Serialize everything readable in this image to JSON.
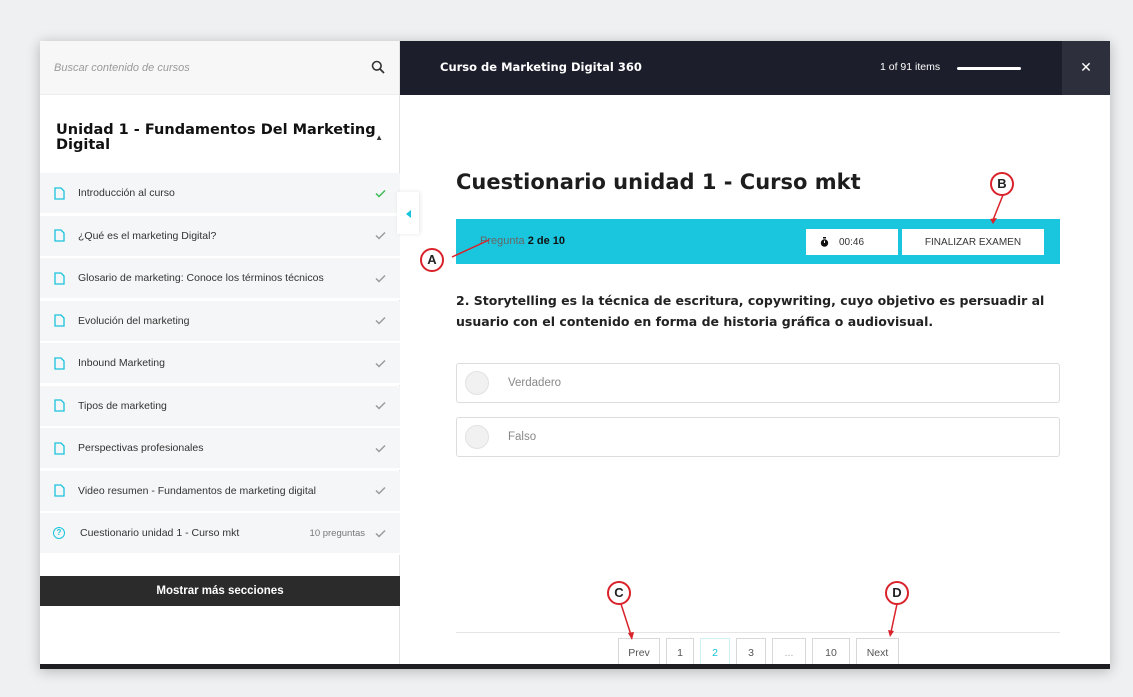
{
  "sidebar": {
    "search_placeholder": "Buscar contenido de cursos",
    "section_title": "Unidad 1 - Fundamentos Del Marketing Digital",
    "lessons": [
      {
        "label": "Introducción al curso",
        "meta": "",
        "completed": true
      },
      {
        "label": "¿Qué es el marketing Digital?",
        "meta": "",
        "completed": false
      },
      {
        "label": "Glosario de marketing: Conoce los términos técnicos",
        "meta": "",
        "completed": false
      },
      {
        "label": "Evolución del marketing",
        "meta": "",
        "completed": false
      },
      {
        "label": "Inbound Marketing",
        "meta": "",
        "completed": false
      },
      {
        "label": "Tipos de marketing",
        "meta": "",
        "completed": false
      },
      {
        "label": "Perspectivas profesionales",
        "meta": "",
        "completed": false
      },
      {
        "label": "Video resumen - Fundamentos de marketing digital",
        "meta": "",
        "completed": false
      },
      {
        "label": "Cuestionario unidad 1 - Curso mkt",
        "meta": "10 preguntas",
        "completed": false
      }
    ],
    "more_sections": "Mostrar más secciones"
  },
  "topbar": {
    "course_title": "Curso de Marketing Digital 360",
    "items_count": "1 of 91 items",
    "close_label": "✕"
  },
  "quiz": {
    "title": "Cuestionario unidad 1 - Curso mkt",
    "question_prefix": "Pregunta",
    "question_number": "2 de 10",
    "timer": "00:46",
    "finish_label": "FINALIZAR EXAMEN",
    "question_text": "2. Storytelling es la técnica de escritura, copywriting, cuyo objetivo es persuadir al usuario con el contenido en forma de historia gráfica o audiovisual.",
    "options": [
      "Verdadero",
      "Falso"
    ]
  },
  "pagination": {
    "prev": "Prev",
    "pages": [
      "1",
      "2",
      "3",
      "...",
      "10"
    ],
    "current": "2",
    "next": "Next"
  },
  "annotations": {
    "a": "A",
    "b": "B",
    "c": "C",
    "d": "D"
  },
  "colors": {
    "accent": "#1ac6dd",
    "topbar": "#1c1e2b",
    "marker": "#d9222a",
    "check_done": "#3cba54"
  }
}
